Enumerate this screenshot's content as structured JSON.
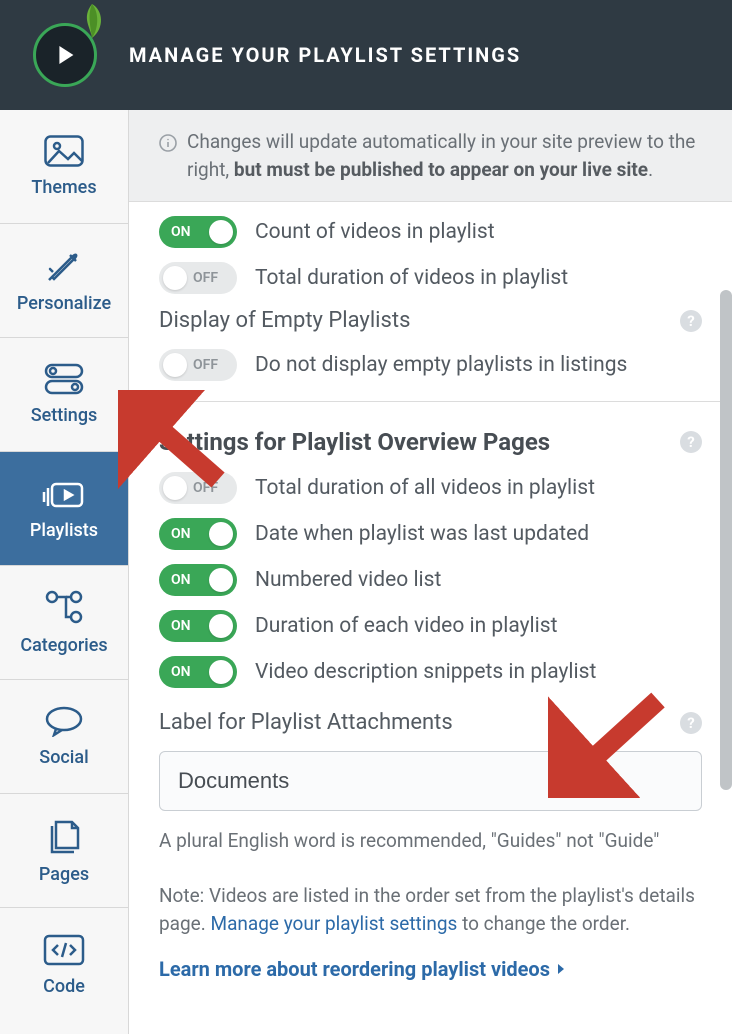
{
  "header": {
    "title": "MANAGE YOUR PLAYLIST SETTINGS"
  },
  "sidebar": {
    "items": [
      {
        "label": "Themes"
      },
      {
        "label": "Personalize"
      },
      {
        "label": "Settings"
      },
      {
        "label": "Playlists"
      },
      {
        "label": "Categories"
      },
      {
        "label": "Social"
      },
      {
        "label": "Pages"
      },
      {
        "label": "Code"
      }
    ]
  },
  "info": {
    "text_prefix": "Changes will update automatically in your site preview to the right, ",
    "text_bold": "but must be published to appear on your live site",
    "text_suffix": "."
  },
  "labels": {
    "on": "ON",
    "off": "OFF"
  },
  "listing": {
    "toggles": [
      {
        "on": true,
        "label": "Count of videos in playlist"
      },
      {
        "on": false,
        "label": "Total duration of videos in playlist"
      }
    ]
  },
  "empty_section": {
    "title": "Display of Empty Playlists",
    "toggle": {
      "on": false,
      "label": "Do not display empty playlists in listings"
    }
  },
  "overview_section": {
    "title": "Settings for Playlist Overview Pages",
    "toggles": [
      {
        "on": false,
        "label": "Total duration of all videos in playlist"
      },
      {
        "on": true,
        "label": "Date when playlist was last updated"
      },
      {
        "on": true,
        "label": "Numbered video list"
      },
      {
        "on": true,
        "label": "Duration of each video in playlist"
      },
      {
        "on": true,
        "label": "Video description snippets in playlist"
      }
    ]
  },
  "attachments": {
    "title": "Label for Playlist Attachments",
    "value": "Documents",
    "hint": "A plural English word is recommended, \"Guides\" not \"Guide\""
  },
  "footer": {
    "note_prefix": "Note: Videos are listed in the order set from the playlist's details page. ",
    "note_link": "Manage your playlist settings",
    "note_suffix": " to change the order.",
    "learn_more": "Learn more about reordering playlist videos"
  }
}
